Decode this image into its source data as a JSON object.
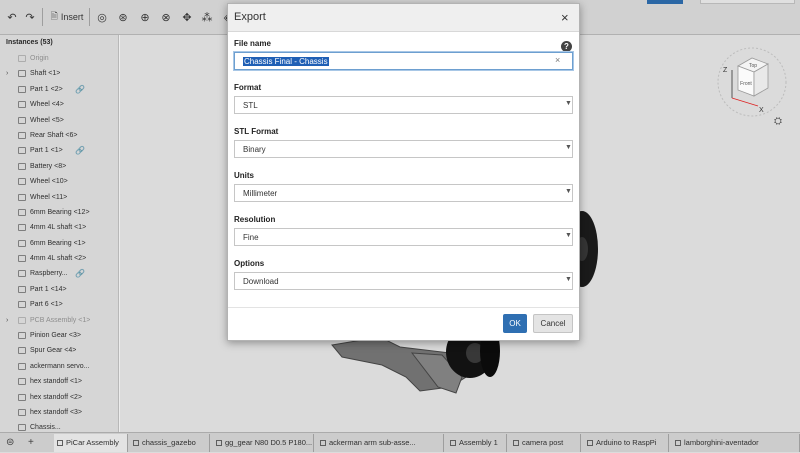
{
  "toolbar": {
    "undo_icon": "undo-icon",
    "redo_icon": "redo-icon",
    "insert_label": "Insert",
    "accent": "#2f6fb2"
  },
  "sidebar": {
    "title": "Instances (53)",
    "items": [
      {
        "label": "Origin",
        "muted": true,
        "expandable": false,
        "link": false
      },
      {
        "label": "Shaft <1>",
        "muted": false,
        "expandable": true,
        "link": false
      },
      {
        "label": "Part 1 <2>",
        "muted": false,
        "expandable": false,
        "link": true
      },
      {
        "label": "Wheel <4>",
        "muted": false,
        "expandable": false,
        "link": false
      },
      {
        "label": "Wheel <5>",
        "muted": false,
        "expandable": false,
        "link": false
      },
      {
        "label": "Rear Shaft <6>",
        "muted": false,
        "expandable": false,
        "link": false
      },
      {
        "label": "Part 1 <1>",
        "muted": false,
        "expandable": false,
        "link": true
      },
      {
        "label": "Battery <8>",
        "muted": false,
        "expandable": false,
        "link": false
      },
      {
        "label": "Wheel <10>",
        "muted": false,
        "expandable": false,
        "link": false
      },
      {
        "label": "Wheel <11>",
        "muted": false,
        "expandable": false,
        "link": false
      },
      {
        "label": "6mm Bearing <12>",
        "muted": false,
        "expandable": false,
        "link": false
      },
      {
        "label": "4mm 4L shaft <1>",
        "muted": false,
        "expandable": false,
        "link": false
      },
      {
        "label": "6mm Bearing <1>",
        "muted": false,
        "expandable": false,
        "link": false
      },
      {
        "label": "4mm 4L shaft <2>",
        "muted": false,
        "expandable": false,
        "link": false
      },
      {
        "label": "Raspberry...",
        "muted": false,
        "expandable": false,
        "link": true
      },
      {
        "label": "Part 1 <14>",
        "muted": false,
        "expandable": false,
        "link": false
      },
      {
        "label": "Part 6 <1>",
        "muted": false,
        "expandable": false,
        "link": false
      },
      {
        "label": "PCB Assembly <1>",
        "muted": true,
        "expandable": true,
        "link": false
      },
      {
        "label": "Pinion Gear <3>",
        "muted": false,
        "expandable": false,
        "link": false
      },
      {
        "label": "Spur Gear <4>",
        "muted": false,
        "expandable": false,
        "link": false
      },
      {
        "label": "ackermann servo...",
        "muted": false,
        "expandable": false,
        "link": false
      },
      {
        "label": "hex standoff <1>",
        "muted": false,
        "expandable": false,
        "link": false
      },
      {
        "label": "hex standoff <2>",
        "muted": false,
        "expandable": false,
        "link": false
      },
      {
        "label": "hex standoff <3>",
        "muted": false,
        "expandable": false,
        "link": false
      },
      {
        "label": "Chassis...",
        "muted": false,
        "expandable": false,
        "link": false
      }
    ]
  },
  "dialog": {
    "title": "Export",
    "close_icon": "close-icon",
    "help_glyph": "?",
    "file_name_label": "File name",
    "file_name_value": "Chassis Final - Chassis",
    "clear_glyph": "×",
    "format_label": "Format",
    "format_value": "STL",
    "stl_format_label": "STL Format",
    "stl_format_value": "Binary",
    "units_label": "Units",
    "units_value": "Millimeter",
    "resolution_label": "Resolution",
    "resolution_value": "Fine",
    "options_label": "Options",
    "options_value": "Download",
    "ok_label": "OK",
    "cancel_label": "Cancel"
  },
  "viewcube": {
    "top_label": "Top",
    "front_label": "Front",
    "axis_z": "Z",
    "axis_x": "X"
  },
  "tabs": [
    {
      "label": "PiCar Assembly",
      "active": true
    },
    {
      "label": "chassis_gazebo",
      "active": false
    },
    {
      "label": "gg_gear N80 D0.5 P180...",
      "active": false
    },
    {
      "label": "ackerman arm sub-asse...",
      "active": false
    },
    {
      "label": "Assembly 1",
      "active": false
    },
    {
      "label": "camera post",
      "active": false
    },
    {
      "label": "Arduino to RaspPi",
      "active": false
    },
    {
      "label": "lamborghini-aventador",
      "active": false
    }
  ]
}
